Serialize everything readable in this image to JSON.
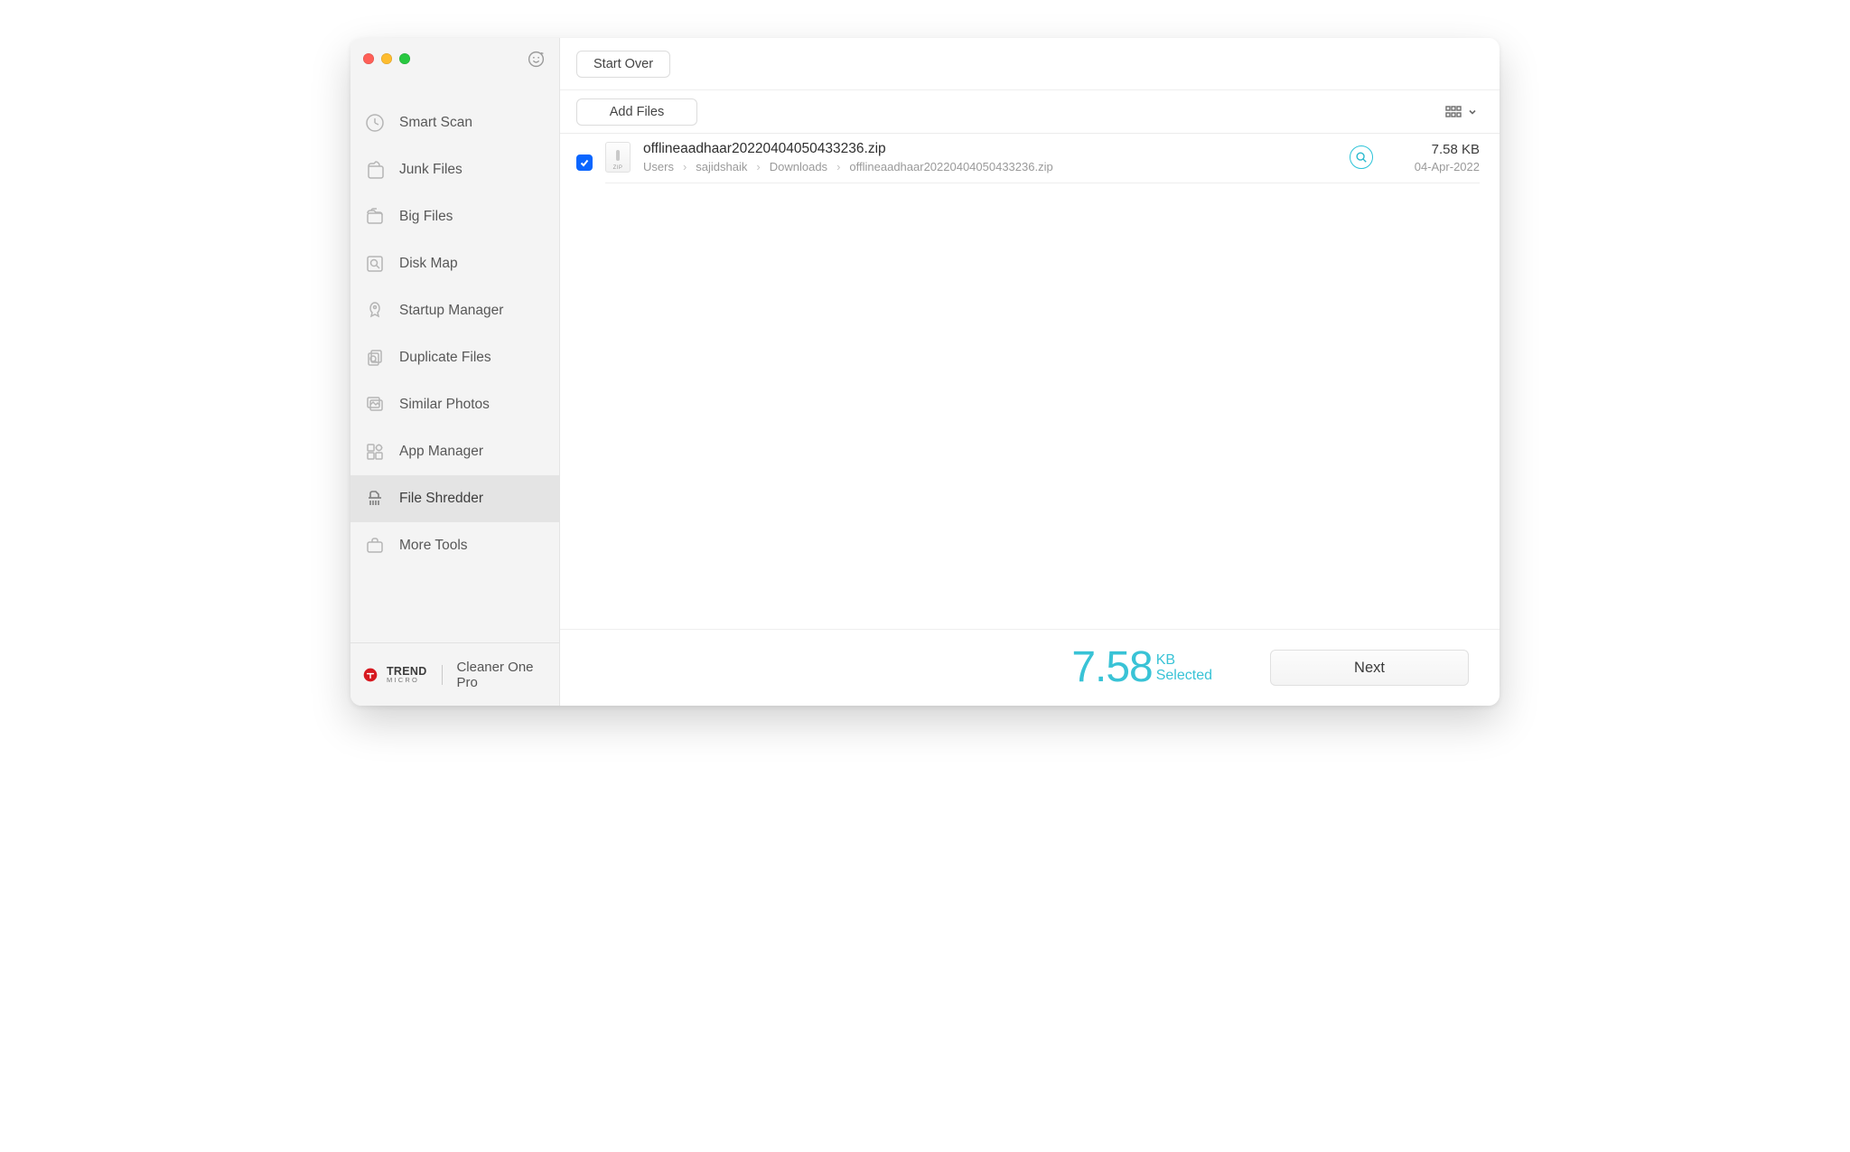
{
  "colors": {
    "accent": "#39c3d6",
    "selection": "#0a66ff"
  },
  "toolbar": {
    "start_over": "Start Over",
    "add_files": "Add Files"
  },
  "sidebar": {
    "items": [
      {
        "label": "Smart Scan",
        "icon": "smart-scan-icon"
      },
      {
        "label": "Junk Files",
        "icon": "junk-files-icon"
      },
      {
        "label": "Big Files",
        "icon": "big-files-icon"
      },
      {
        "label": "Disk Map",
        "icon": "disk-map-icon"
      },
      {
        "label": "Startup Manager",
        "icon": "startup-manager-icon"
      },
      {
        "label": "Duplicate Files",
        "icon": "duplicate-files-icon"
      },
      {
        "label": "Similar Photos",
        "icon": "similar-photos-icon"
      },
      {
        "label": "App Manager",
        "icon": "app-manager-icon"
      },
      {
        "label": "File Shredder",
        "icon": "file-shredder-icon"
      },
      {
        "label": "More Tools",
        "icon": "more-tools-icon"
      }
    ],
    "active_index": 8
  },
  "brand": {
    "name": "TREND",
    "sub": "MICRO",
    "product": "Cleaner One Pro"
  },
  "files": [
    {
      "checked": true,
      "name": "offlineaadhaar20220404050433236.zip",
      "path": [
        "Users",
        "sajidshaik",
        "Downloads",
        "offlineaadhaar20220404050433236.zip"
      ],
      "size": "7.58 KB",
      "date": "04-Apr-2022",
      "kind": "zip"
    }
  ],
  "selected_summary": {
    "number": "7.58",
    "unit": "KB",
    "label": "Selected"
  },
  "footer": {
    "next": "Next"
  }
}
